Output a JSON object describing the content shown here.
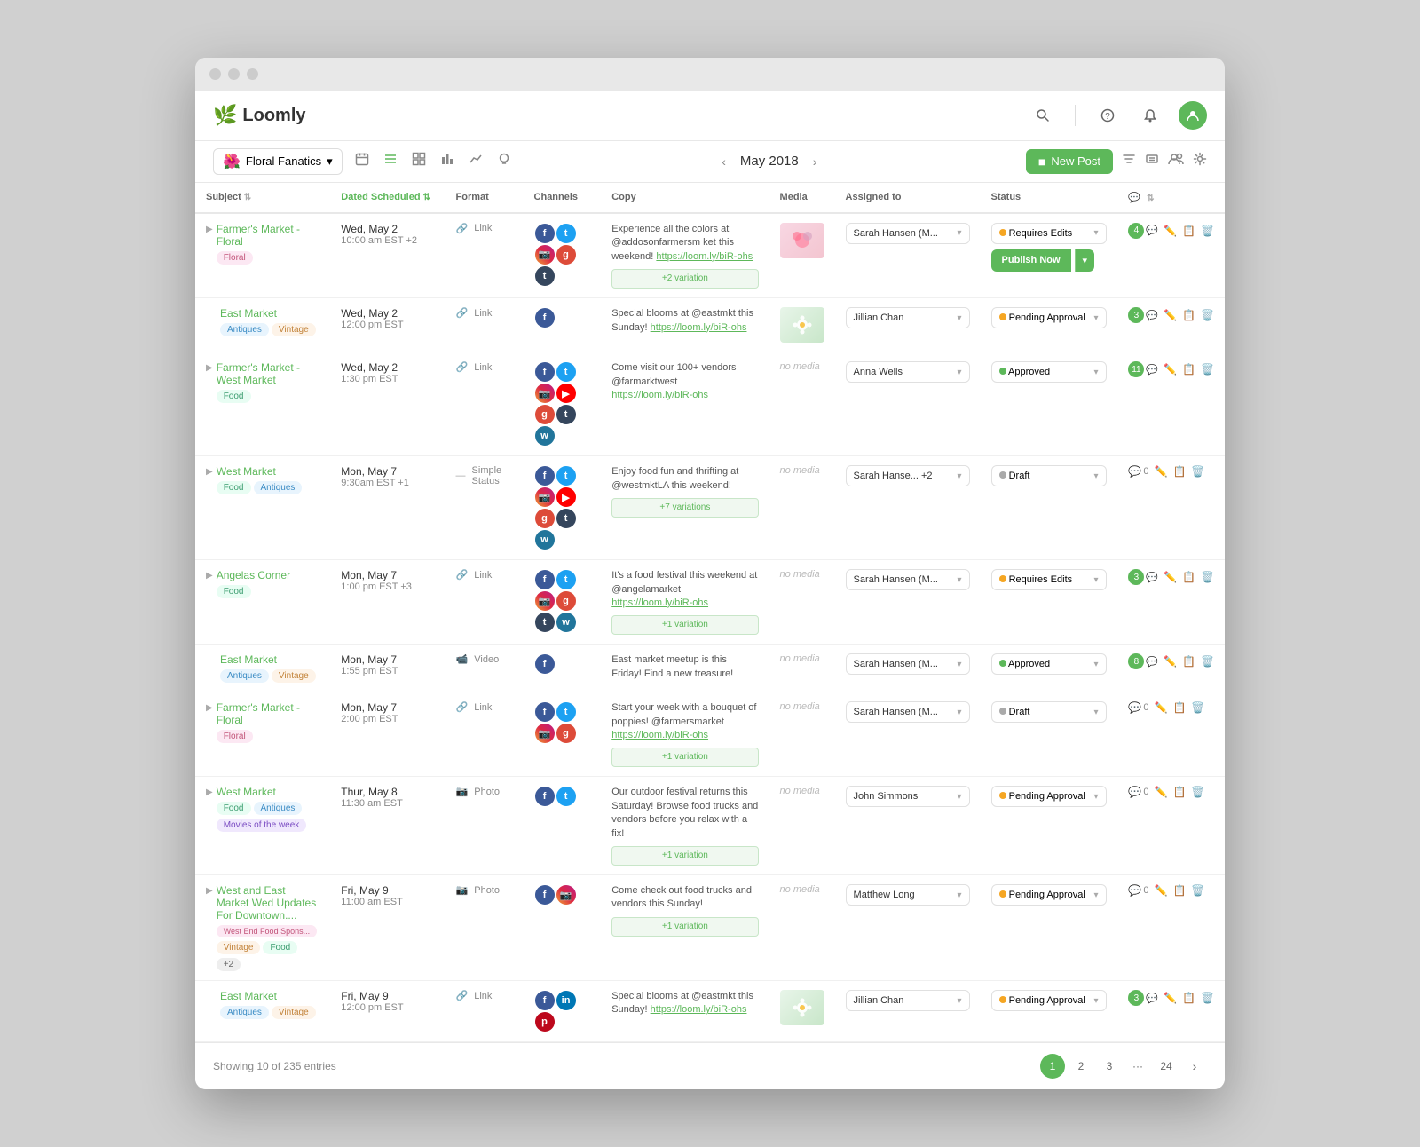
{
  "app": {
    "title": "Loomly",
    "logo_icon": "🌿"
  },
  "header": {
    "search_label": "search",
    "help_label": "help",
    "notifications_label": "notifications",
    "user_label": "user"
  },
  "toolbar": {
    "brand": "Floral Fanatics",
    "month": "May 2018",
    "new_post_label": "New Post",
    "icons": [
      "calendar",
      "list",
      "grid",
      "chart-bar",
      "chart-line",
      "bulb"
    ]
  },
  "table": {
    "columns": [
      {
        "label": "Subject",
        "key": "subject",
        "sort": true
      },
      {
        "label": "Dated Scheduled",
        "key": "date",
        "sort": true,
        "green": true
      },
      {
        "label": "Format",
        "key": "format"
      },
      {
        "label": "Channels",
        "key": "channels"
      },
      {
        "label": "Copy",
        "key": "copy"
      },
      {
        "label": "Media",
        "key": "media"
      },
      {
        "label": "Assigned to",
        "key": "assigned"
      },
      {
        "label": "Status",
        "key": "status"
      }
    ],
    "rows": [
      {
        "id": 1,
        "subject": "Farmer's Market - Floral",
        "tags": [
          {
            "label": "Floral",
            "type": "floral"
          }
        ],
        "date": "Wed, May 2",
        "time": "10:00 am EST +2",
        "format": "Link",
        "format_icon": "link",
        "channels": [
          "fb",
          "tw",
          "ig",
          "gp",
          "tu"
        ],
        "copy": "Experience all the colors at @addosonfarmersm ket this weekend!",
        "copy_link": "https://loom.ly/biR-ohs",
        "variation": "+2 variation",
        "media": "image",
        "media_type": "flower",
        "assigned": "Sarah Hansen (M...",
        "status": "Requires Edits",
        "status_type": "orange",
        "comments": 4,
        "has_publish": true,
        "expand": true
      },
      {
        "id": 2,
        "subject": "East Market",
        "tags": [
          {
            "label": "Antiques",
            "type": "antiques"
          },
          {
            "label": "Vintage",
            "type": "vintage"
          }
        ],
        "date": "Wed, May 2",
        "time": "12:00 pm EST",
        "format": "Link",
        "format_icon": "link",
        "channels": [
          "fb"
        ],
        "copy": "Special blooms at @eastmkt this Sunday!",
        "copy_link": "https://loom.ly/biR-ohs",
        "variation": null,
        "media": "image",
        "media_type": "daisy",
        "assigned": "Jillian Chan",
        "status": "Pending Approval",
        "status_type": "orange",
        "comments": 3,
        "has_publish": false,
        "expand": false
      },
      {
        "id": 3,
        "subject": "Farmer's Market - West Market",
        "tags": [
          {
            "label": "Food",
            "type": "food"
          }
        ],
        "date": "Wed, May 2",
        "time": "1:30 pm EST",
        "format": "Link",
        "format_icon": "link",
        "channels": [
          "fb",
          "tw",
          "ig",
          "yt",
          "gp",
          "tu",
          "wp"
        ],
        "copy": "Come visit our 100+ vendors @farmarktwest",
        "copy_link": "https://loom.ly/biR-ohs",
        "variation": null,
        "media": "no media",
        "media_type": null,
        "assigned": "Anna Wells",
        "status": "Approved",
        "status_type": "green",
        "comments": 11,
        "has_publish": false,
        "expand": true
      },
      {
        "id": 4,
        "subject": "West Market",
        "tags": [
          {
            "label": "Food",
            "type": "food"
          },
          {
            "label": "Antiques",
            "type": "antiques"
          }
        ],
        "date": "Mon, May 7",
        "time": "9:30am EST +1",
        "format": "Simple Status",
        "format_icon": "minus",
        "channels": [
          "fb",
          "tw",
          "ig",
          "yt",
          "gp",
          "tu",
          "wp"
        ],
        "copy": "Enjoy food fun and thrifting at @westmktLA this weekend!",
        "copy_link": null,
        "variation": "+7 variations",
        "media": "no media",
        "media_type": null,
        "assigned": "Sarah Hanse... +2",
        "status": "Draft",
        "status_type": "gray",
        "comments": 0,
        "has_publish": false,
        "expand": true
      },
      {
        "id": 5,
        "subject": "Angelas Corner",
        "tags": [
          {
            "label": "Food",
            "type": "food"
          }
        ],
        "date": "Mon, May 7",
        "time": "1:00 pm EST +3",
        "format": "Link",
        "format_icon": "link",
        "channels": [
          "fb",
          "tw",
          "ig",
          "gp",
          "tu",
          "wp"
        ],
        "copy": "It's a food festival this weekend at @angelamarket",
        "copy_link": "https://loom.ly/biR-ohs",
        "variation": "+1 variation",
        "media": "no media",
        "media_type": null,
        "assigned": "Sarah Hansen (M...",
        "status": "Requires Edits",
        "status_type": "orange",
        "comments": 3,
        "has_publish": false,
        "expand": true
      },
      {
        "id": 6,
        "subject": "East Market",
        "tags": [
          {
            "label": "Antiques",
            "type": "antiques"
          },
          {
            "label": "Vintage",
            "type": "vintage"
          }
        ],
        "date": "Mon, May 7",
        "time": "1:55 pm EST",
        "format": "Video",
        "format_icon": "video",
        "channels": [
          "fb"
        ],
        "copy": "East market meetup is this Friday! Find a new treasure!",
        "copy_link": null,
        "variation": null,
        "media": "no media",
        "media_type": null,
        "assigned": "Sarah Hansen (M...",
        "status": "Approved",
        "status_type": "green",
        "comments": 8,
        "has_publish": false,
        "expand": false
      },
      {
        "id": 7,
        "subject": "Farmer's Market - Floral",
        "tags": [
          {
            "label": "Floral",
            "type": "floral"
          }
        ],
        "date": "Mon, May 7",
        "time": "2:00 pm EST",
        "format": "Link",
        "format_icon": "link",
        "channels": [
          "fb",
          "tw",
          "ig",
          "gp"
        ],
        "copy": "Start your week with a bouquet of poppies! @farmersmarket",
        "copy_link": "https://loom.ly/biR-ohs",
        "variation": "+1 variation",
        "media": "no media",
        "media_type": null,
        "assigned": "Sarah Hansen (M...",
        "status": "Draft",
        "status_type": "gray",
        "comments": 0,
        "has_publish": false,
        "expand": true
      },
      {
        "id": 8,
        "subject": "West Market",
        "tags": [
          {
            "label": "Food",
            "type": "food"
          },
          {
            "label": "Antiques",
            "type": "antiques"
          },
          {
            "label": "Movies of the week",
            "type": "movies"
          }
        ],
        "date": "Thur, May 8",
        "time": "11:30 am EST",
        "format": "Photo",
        "format_icon": "photo",
        "channels": [
          "fb",
          "tw"
        ],
        "copy": "Our outdoor festival returns this Saturday! Browse food trucks and vendors before you relax with a fix!",
        "copy_link": null,
        "variation": "+1 variation",
        "media": "no media",
        "media_type": null,
        "assigned": "John Simmons",
        "status": "Pending Approval",
        "status_type": "orange",
        "comments": 0,
        "has_publish": false,
        "expand": true
      },
      {
        "id": 9,
        "subject": "West and East Market Wed Updates For Downtown....",
        "tags": [
          {
            "label": "West End Food Spons...",
            "type": "west"
          },
          {
            "label": "Vintage",
            "type": "vintage"
          },
          {
            "label": "Food",
            "type": "food"
          },
          {
            "label": "+2",
            "type": "more"
          }
        ],
        "date": "Fri, May 9",
        "time": "11:00 am EST",
        "format": "Photo",
        "format_icon": "photo",
        "channels": [
          "fb",
          "ig"
        ],
        "copy": "Come check out food trucks and vendors this Sunday!",
        "copy_link": null,
        "variation": "+1 variation",
        "media": "no media",
        "media_type": null,
        "assigned": "Matthew Long",
        "status": "Pending Approval",
        "status_type": "orange",
        "comments": 0,
        "has_publish": false,
        "expand": true
      },
      {
        "id": 10,
        "subject": "East Market",
        "tags": [
          {
            "label": "Antiques",
            "type": "antiques"
          },
          {
            "label": "Vintage",
            "type": "vintage"
          }
        ],
        "date": "Fri, May 9",
        "time": "12:00 pm EST",
        "format": "Link",
        "format_icon": "link",
        "channels": [
          "fb",
          "li",
          "pi"
        ],
        "copy": "Special blooms at @eastmkt this Sunday!",
        "copy_link": "https://loom.ly/biR-ohs",
        "variation": null,
        "media": "image",
        "media_type": "daisy2",
        "assigned": "Jillian Chan",
        "status": "Pending Approval",
        "status_type": "orange",
        "comments": 3,
        "has_publish": false,
        "expand": false
      }
    ]
  },
  "pagination": {
    "showing": "Showing 10 of 235 entries",
    "pages": [
      "1",
      "2",
      "3",
      "...",
      "24"
    ],
    "active": "1"
  }
}
